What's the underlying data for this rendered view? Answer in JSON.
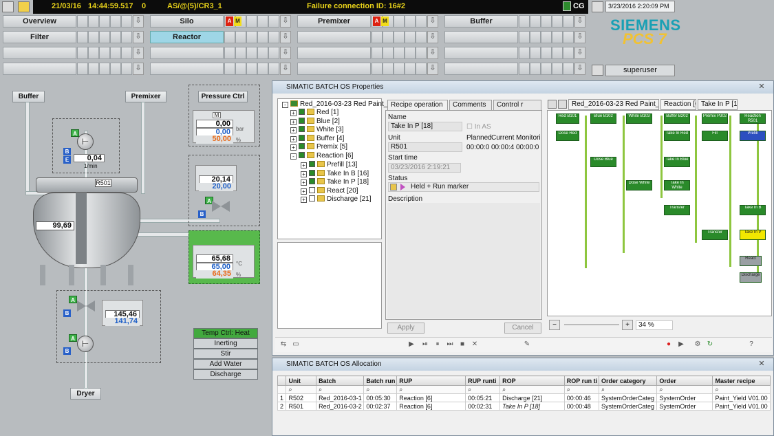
{
  "top_bar": {
    "date": "21/03/16",
    "time": "14:44:59.517",
    "counter": "0",
    "area": "AS/@(5)/CR3_1",
    "alarm_text": "Failure connection ID: 16#2",
    "cg_label": "CG"
  },
  "datetime_box": "3/23/2016 2:20:09 PM",
  "user": "superuser",
  "logo": {
    "brand": "SIEMENS",
    "product": "PCS 7"
  },
  "nav": {
    "row1": [
      "Overview",
      "Silo",
      "Premixer",
      "Buffer"
    ],
    "row2": [
      "Filter",
      "Reactor"
    ],
    "flags": [
      "A",
      "M"
    ]
  },
  "process": {
    "buffer_label": "Buffer",
    "premixer_label": "Premixer",
    "pressure_label": "Pressure Ctrl",
    "dryer_label": "Dryer",
    "reactor_label": "R501",
    "reactor_level": "99,69",
    "motor_top_value": "0,04",
    "motor_top_unit": "1/min",
    "pressure": {
      "pv": "0,00",
      "sp": "0,00",
      "out": "50,00",
      "unit": "bar",
      "out_unit": "%",
      "mode": "M"
    },
    "inlet": {
      "pv": "20,14",
      "sp": "20,00"
    },
    "temp": {
      "pv": "65,68",
      "sp": "65,00",
      "out": "64,35",
      "unit": "°C",
      "out_unit": "%"
    },
    "outlet": {
      "pv": "145,46",
      "sp": "141,74"
    },
    "letters": {
      "A": "A",
      "B": "B",
      "E": "E"
    },
    "commands": [
      "Temp Ctrl: Heat",
      "Inerting",
      "Stir",
      "Add Water",
      "Discharge"
    ]
  },
  "batch_props": {
    "title": "SIMATIC BATCH OS Properties",
    "tree_root": "Red_2016-03-23 Red Paint_",
    "tree": [
      "Red [1]",
      "Blue [2]",
      "White [3]",
      "Buffer [4]",
      "Premix [5]",
      "Reaction [6]"
    ],
    "tree_sub": [
      "Prefill [13]",
      "Take In B [16]",
      "Take In P [18]",
      "React [20]",
      "Discharge [21]"
    ],
    "tabs": [
      "Recipe operation",
      "Comments",
      "Control r"
    ],
    "name_label": "Name",
    "name_value": "Take In P [18]",
    "in_as": "In AS",
    "unit_label": "Unit",
    "unit_value": "R501",
    "cols": [
      "Planned",
      "Current r",
      "Monitorin"
    ],
    "col_vals": [
      "00:00:0",
      "00:00:4",
      "00:00:0"
    ],
    "start_label": "Start time",
    "start_value": "03/23/2016 2:19:21",
    "status_label": "Status",
    "status_value": "Held + Run marker",
    "desc_label": "Description",
    "apply": "Apply",
    "cancel": "Cancel",
    "graph_tabs": [
      "Red_2016-03-23 Red Paint_1 [62]",
      "Reaction [6]",
      "Take In P [18]"
    ],
    "zoom": "34 %",
    "graph_blocks": [
      "Red B101",
      "Blue B102",
      "White B103",
      "Buffer B202",
      "Premix P302",
      "Reaction R501",
      "Dose Red",
      "Take In Red",
      "Fill",
      "Prefill",
      "Dose Blue",
      "Take In Blue",
      "Dose White",
      "Take In White",
      "Transfer",
      "Take In B",
      "Transfer",
      "Take In P",
      "React",
      "Discharge"
    ]
  },
  "allocation": {
    "title": "SIMATIC BATCH OS Allocation",
    "headers": [
      "Unit",
      "Batch",
      "Batch run",
      "RUP",
      "RUP runti",
      "ROP",
      "ROP run ti",
      "Order category",
      "Order",
      "Master recipe"
    ],
    "rows": [
      [
        "1",
        "R502",
        "Red_2016-03-1",
        "00:05:30",
        "Reaction [6]",
        "00:05:21",
        "Discharge [21]",
        "00:00:46",
        "SystemOrderCateg",
        "SystemOrder",
        "Paint_Yield V01.00"
      ],
      [
        "2",
        "R501",
        "Red_2016-03-2",
        "00:02:37",
        "Reaction [6]",
        "00:02:31",
        "Take In P [18]",
        "00:00:48",
        "SystemOrderCateg",
        "SystemOrder",
        "Paint_Yield V01.00"
      ]
    ]
  },
  "colors": {
    "accent_green": "#3fb24a",
    "alarm_yellow": "#e8d21a",
    "siemens_teal": "#19a0b4",
    "pcs7_yellow": "#f1c232"
  }
}
